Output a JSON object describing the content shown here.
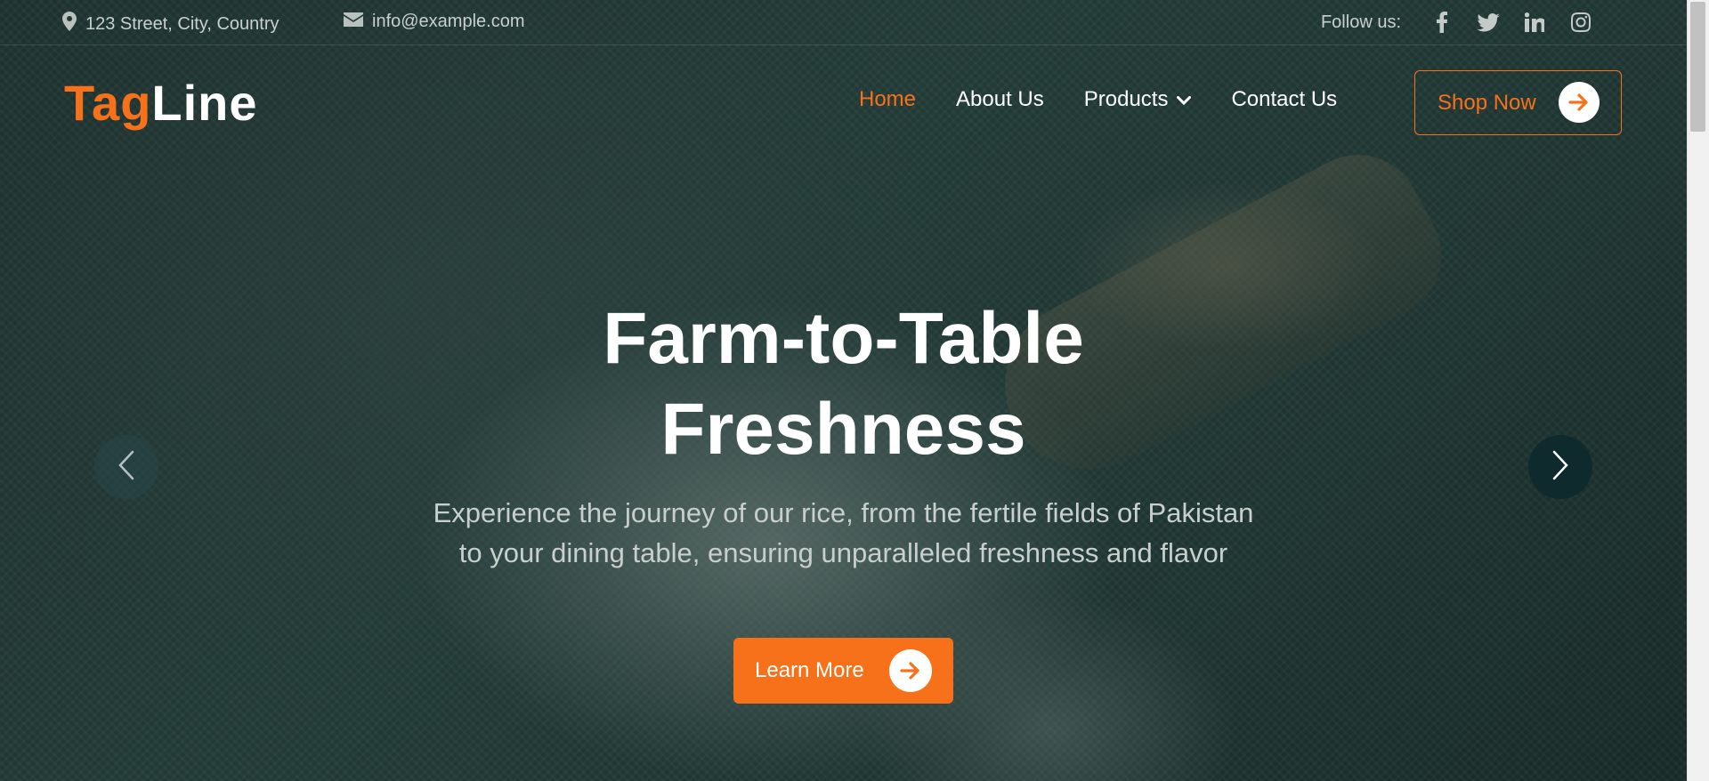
{
  "topbar": {
    "address": "123 Street, City, Country",
    "email": "info@example.com",
    "follow_label": "Follow us:",
    "socials": [
      {
        "icon": "facebook-icon"
      },
      {
        "icon": "twitter-icon"
      },
      {
        "icon": "linkedin-icon"
      },
      {
        "icon": "instagram-icon"
      }
    ]
  },
  "logo": {
    "part1": "Tag",
    "part2": "Line"
  },
  "nav": {
    "items": [
      {
        "label": "Home",
        "active": true
      },
      {
        "label": "About Us"
      },
      {
        "label": "Products",
        "dropdown": true
      },
      {
        "label": "Contact Us"
      }
    ],
    "cta": "Shop Now"
  },
  "hero": {
    "title_line1": "Farm-to-Table",
    "title_line2": "Freshness",
    "subtitle_line1": "Experience the journey of our rice, from the fertile fields of Pakistan",
    "subtitle_line2": "to your dining table, ensuring unparalleled freshness and flavor",
    "button": "Learn More"
  },
  "colors": {
    "accent": "#f7711a",
    "overlay": "#1f3330",
    "text": "#ffffff"
  }
}
